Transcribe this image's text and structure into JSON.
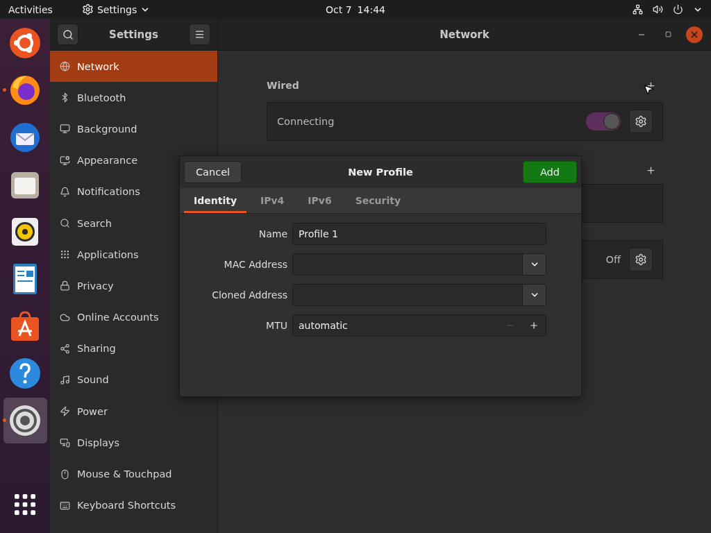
{
  "top_bar": {
    "activities": "Activities",
    "app_menu": "Settings",
    "date": "Oct 7",
    "time": "14:44"
  },
  "dock": [
    {
      "running": false,
      "selected": false
    },
    {
      "running": true,
      "selected": false
    },
    {
      "running": false,
      "selected": false
    },
    {
      "running": false,
      "selected": false
    },
    {
      "running": false,
      "selected": false
    },
    {
      "running": false,
      "selected": false
    },
    {
      "running": false,
      "selected": false
    },
    {
      "running": false,
      "selected": false
    },
    {
      "running": true,
      "selected": true
    },
    {
      "running": false,
      "selected": false
    }
  ],
  "window": {
    "sidebar_title": "Settings",
    "title": "Network"
  },
  "sidebar": {
    "items": [
      {
        "label": "Network",
        "selected": true
      },
      {
        "label": "Bluetooth",
        "selected": false
      },
      {
        "label": "Background",
        "selected": false
      },
      {
        "label": "Appearance",
        "selected": false
      },
      {
        "label": "Notifications",
        "selected": false
      },
      {
        "label": "Search",
        "selected": false
      },
      {
        "label": "Applications",
        "selected": false
      },
      {
        "label": "Privacy",
        "selected": false
      },
      {
        "label": "Online Accounts",
        "selected": false
      },
      {
        "label": "Sharing",
        "selected": false
      },
      {
        "label": "Sound",
        "selected": false
      },
      {
        "label": "Power",
        "selected": false
      },
      {
        "label": "Displays",
        "selected": false
      },
      {
        "label": "Mouse & Touchpad",
        "selected": false
      },
      {
        "label": "Keyboard Shortcuts",
        "selected": false
      }
    ]
  },
  "wired": {
    "title": "Wired",
    "status": "Connecting",
    "on": true
  },
  "section_3": {
    "status": "Off"
  },
  "dialog": {
    "cancel": "Cancel",
    "title": "New Profile",
    "confirm": "Add",
    "tabs": [
      {
        "label": "Identity",
        "selected": true
      },
      {
        "label": "IPv4",
        "selected": false
      },
      {
        "label": "IPv6",
        "selected": false
      },
      {
        "label": "Security",
        "selected": false
      }
    ],
    "fields": [
      {
        "label": "Name",
        "kind": "text",
        "value": "Profile 1"
      },
      {
        "label": "MAC Address",
        "kind": "combo"
      },
      {
        "label": "Cloned Address",
        "kind": "combo"
      },
      {
        "label": "MTU",
        "kind": "spin",
        "value": "automatic",
        "minus_disabled": true
      }
    ]
  }
}
